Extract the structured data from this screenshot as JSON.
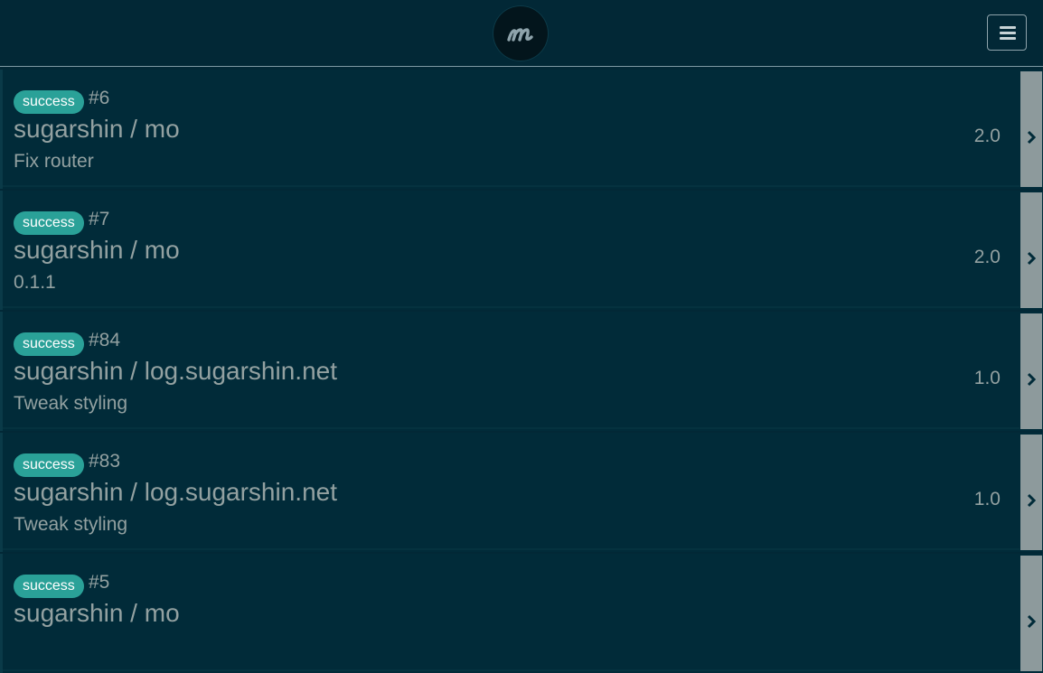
{
  "header": {
    "logo_icon": "m-logo-icon",
    "menu_icon": "hamburger-menu-icon"
  },
  "builds": [
    {
      "status": "success",
      "number": "#6",
      "repo": "sugarshin / mo",
      "message": "Fix router",
      "duration": "2.0"
    },
    {
      "status": "success",
      "number": "#7",
      "repo": "sugarshin / mo",
      "message": "0.1.1",
      "duration": "2.0"
    },
    {
      "status": "success",
      "number": "#84",
      "repo": "sugarshin / log.sugarshin.net",
      "message": "Tweak styling",
      "duration": "1.0"
    },
    {
      "status": "success",
      "number": "#83",
      "repo": "sugarshin / log.sugarshin.net",
      "message": "Tweak styling",
      "duration": "1.0"
    },
    {
      "status": "success",
      "number": "#5",
      "repo": "sugarshin / mo",
      "message": "",
      "duration": ""
    }
  ],
  "colors": {
    "background": "#022836",
    "badge_success": "#2aa198",
    "text": "#93a1a1",
    "chevron_bar": "#8d9a9c"
  }
}
